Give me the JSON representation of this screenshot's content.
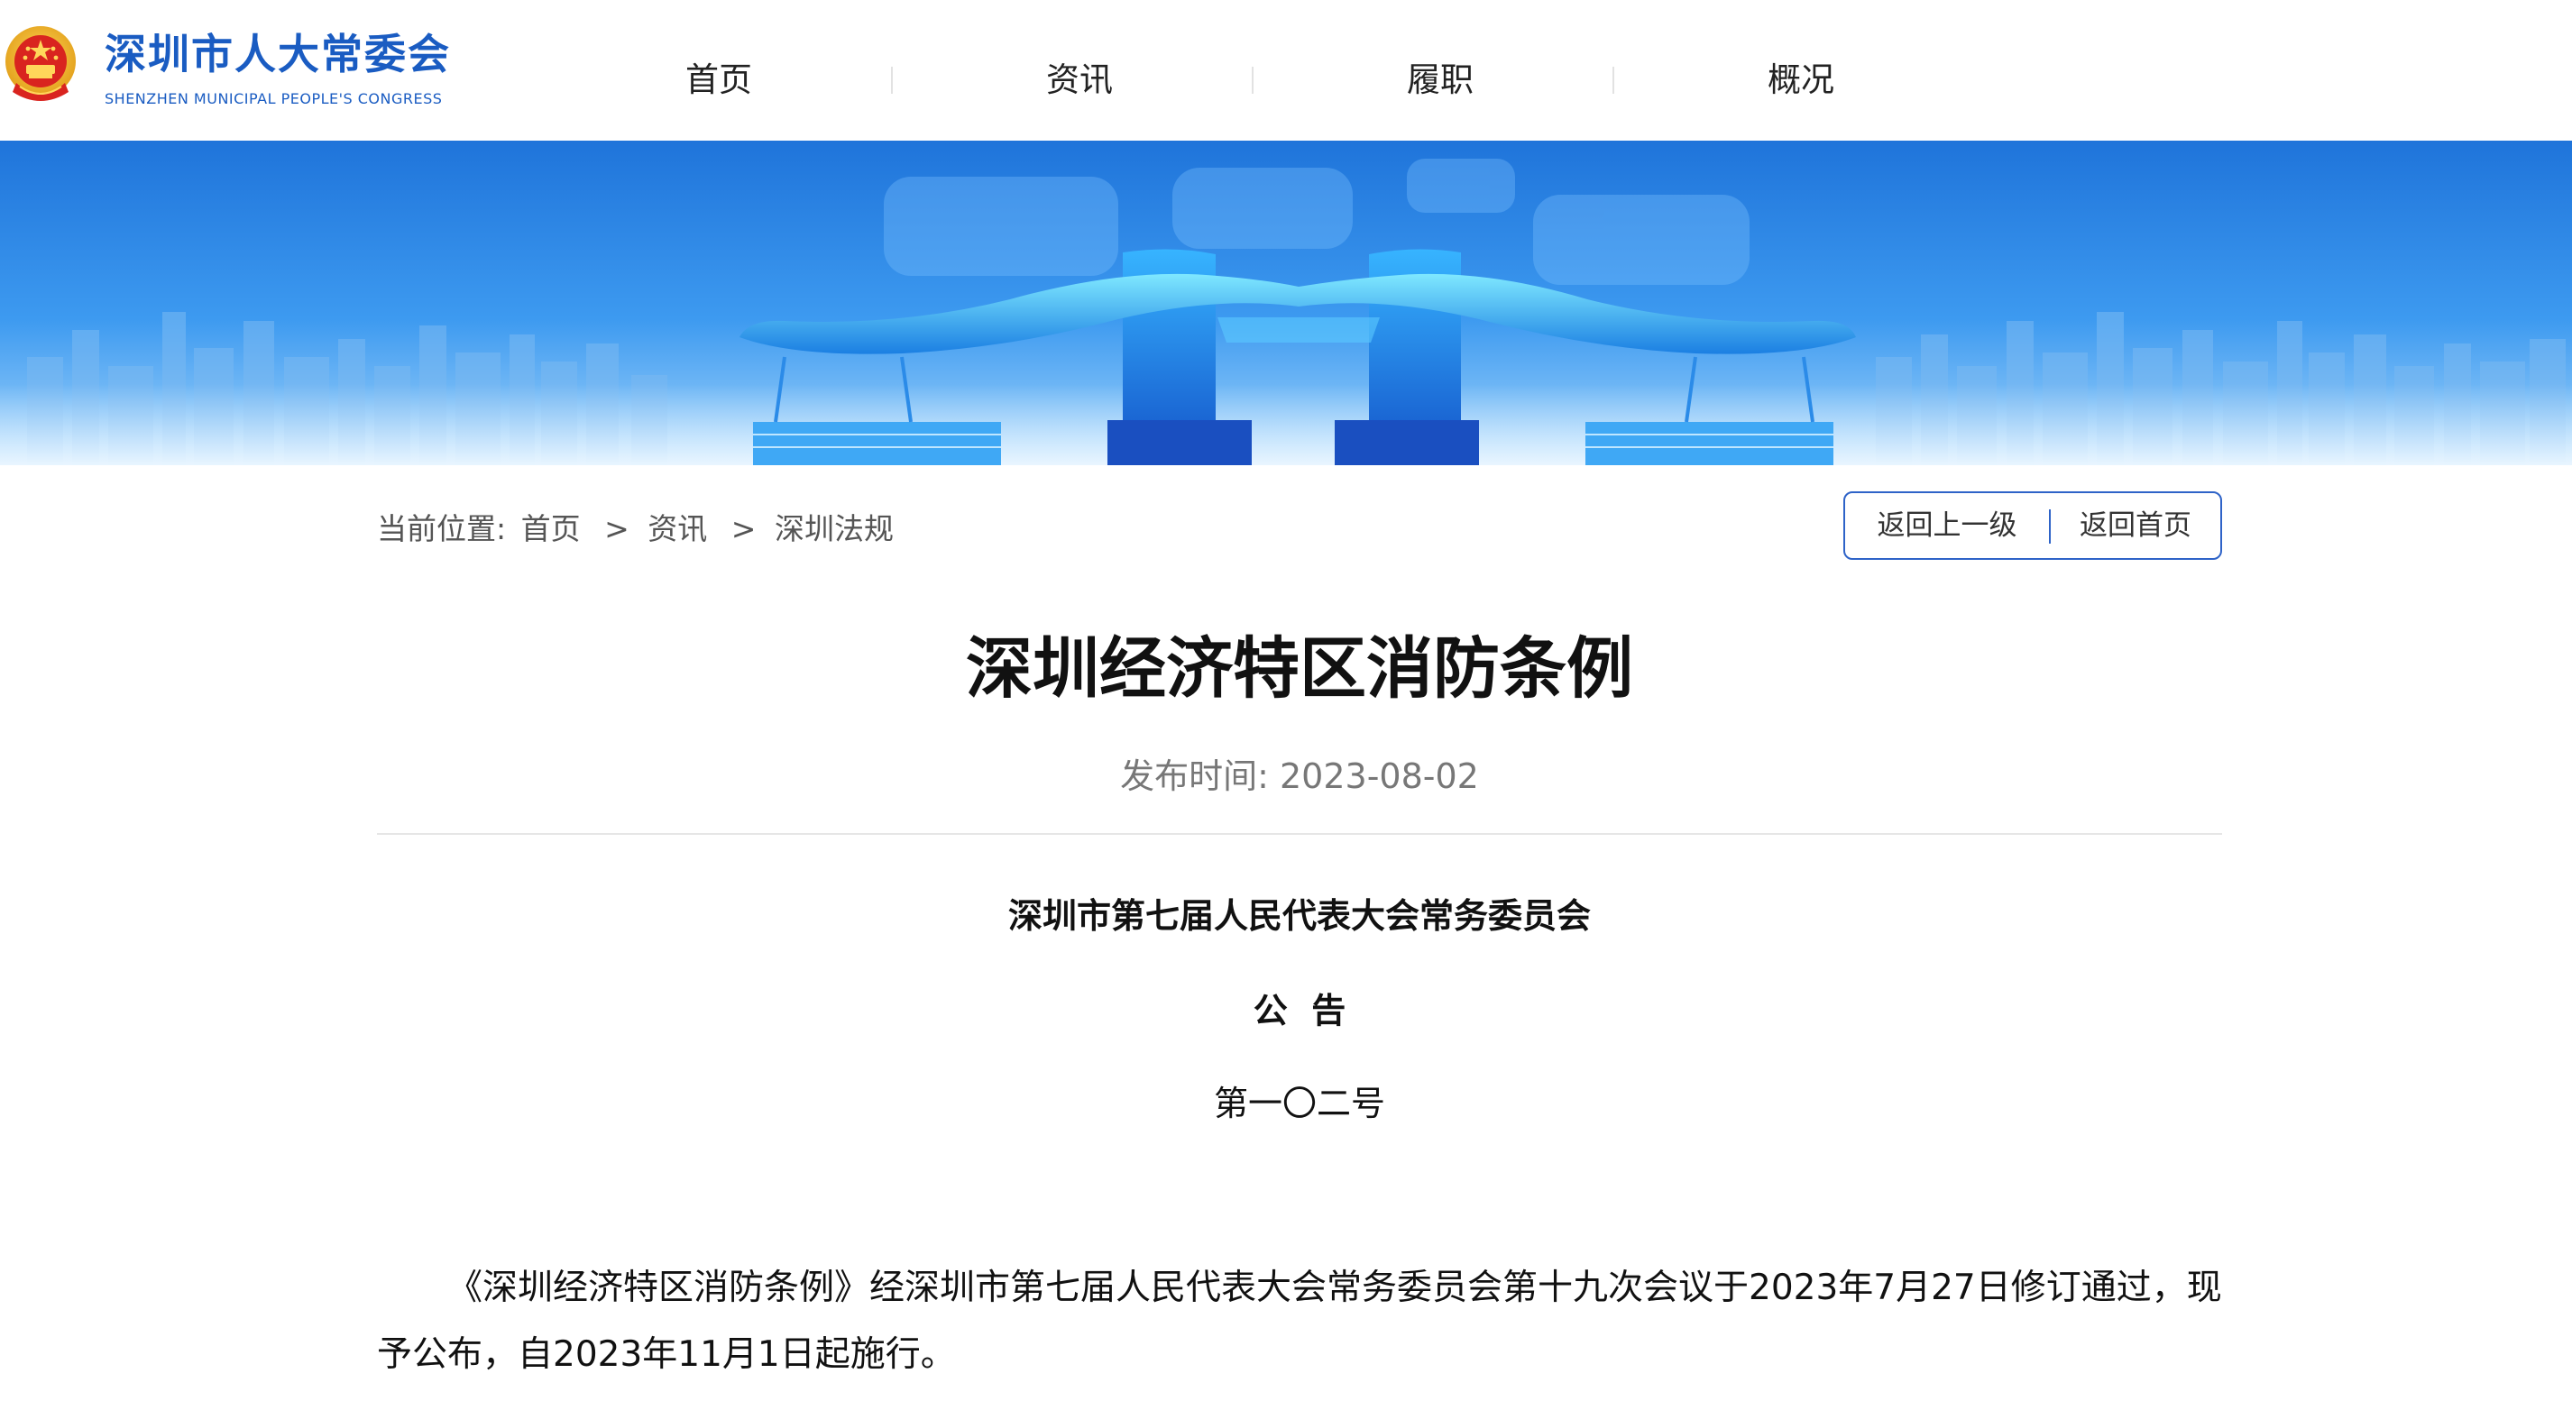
{
  "header": {
    "site_title": "深圳市人大常委会",
    "site_subtitle": "SHENZHEN MUNICIPAL PEOPLE'S CONGRESS",
    "logo_icon": "national-emblem-icon",
    "nav": [
      {
        "label": "首页"
      },
      {
        "label": "资讯"
      },
      {
        "label": "履职"
      },
      {
        "label": "概况"
      }
    ]
  },
  "breadcrumb": {
    "prefix": "当前位置:",
    "items": [
      "首页",
      "资讯",
      "深圳法规"
    ],
    "separator": ">"
  },
  "actions": {
    "back_up": "返回上一级",
    "back_home": "返回首页"
  },
  "article": {
    "title": "深圳经济特区消防条例",
    "publish_date": "发布时间: 2023-08-02",
    "issuer": "深圳市第七届人民代表大会常务委员会",
    "notice": "公  告",
    "number": "第一〇二号",
    "body": "《深圳经济特区消防条例》经深圳市第七届人民代表大会常务委员会第十九次会议于2023年7月27日修订通过，现予公布，自2023年11月1日起施行。"
  },
  "colors": {
    "brand_blue": "#1a5cc2",
    "button_border": "#2e63c8",
    "banner_blue": "#2f8de6"
  }
}
